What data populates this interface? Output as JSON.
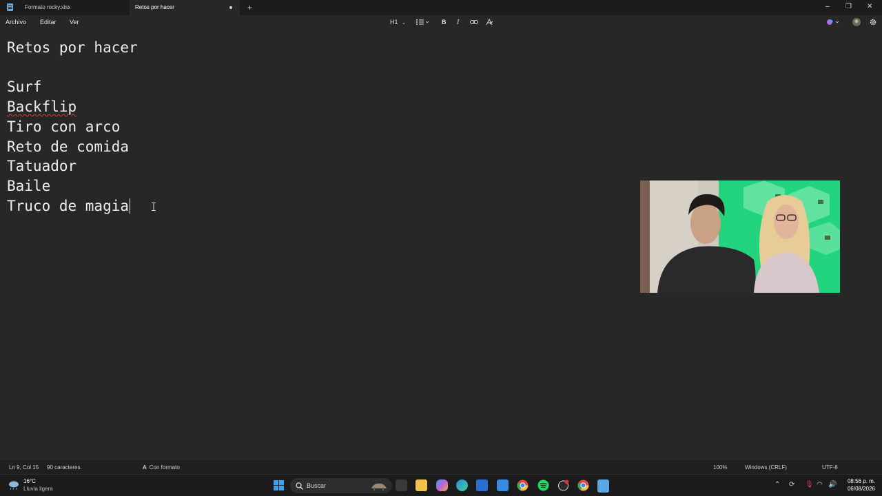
{
  "tabs": [
    {
      "label": "Formato rocky.xlsx",
      "active": false
    },
    {
      "label": "Retos por hacer",
      "active": true,
      "unsaved": true
    }
  ],
  "window_controls": {
    "new_tab": "+",
    "minimize": "–",
    "restore": "❐",
    "close": "✕"
  },
  "menu": {
    "file": "Archivo",
    "edit": "Editar",
    "view": "Ver"
  },
  "toolbar": {
    "heading": "H1",
    "bold": "B",
    "italic": "I"
  },
  "document": {
    "lines": [
      "Retos por hacer",
      "",
      "Surf",
      "Backflip",
      "Tiro con arco",
      "Reto de comida",
      "Tatuador",
      "Baile",
      "Truco de magia"
    ],
    "misspelled": "Backflip"
  },
  "status": {
    "position": "Ln 9, Col 15",
    "chars": "90 caracteres.",
    "format": "Con formato",
    "zoom": "100%",
    "line_ending": "Windows (CRLF)",
    "encoding": "UTF-8"
  },
  "taskbar": {
    "temperature": "16°C",
    "weather": "Lluvia ligera",
    "search_placeholder": "Buscar",
    "time": "08:56 p. m.",
    "date": "06/08/2026"
  },
  "colors": {
    "background": "#272727",
    "titlebar": "#1c1c1c",
    "text": "#ededed",
    "accent": "#5aa7e6",
    "webcam_bg": "#1fd47c"
  }
}
